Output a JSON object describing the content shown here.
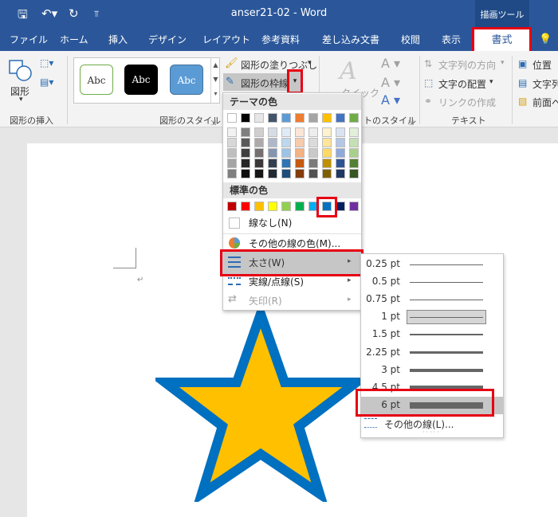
{
  "window": {
    "title": "anser21-02  -  Word",
    "drawing_tools": "描画ツール"
  },
  "tabs": [
    "ファイル",
    "ホーム",
    "挿入",
    "デザイン",
    "レイアウト",
    "参考資料",
    "差し込み文書",
    "校閲",
    "表示"
  ],
  "active_tab": "書式",
  "help_icon": "light-bulb-icon",
  "ribbon": {
    "insert_shapes": {
      "shape_label": "図形",
      "group_label": "図形の挿入"
    },
    "shape_styles": {
      "abc": [
        "Abc",
        "Abc",
        "Abc"
      ],
      "group_label": "図形のスタイル",
      "fill": "図形の塗りつぶし",
      "outline": "図形の枠線"
    },
    "wordart": {
      "quick_style": "クイック",
      "group_label": "トのスタイル"
    },
    "text": {
      "direction": "文字列の方向",
      "align": "文字の配置",
      "link": "リンクの作成",
      "group_label": "テキスト"
    },
    "arrange": {
      "position": "位置",
      "wrap": "文字列",
      "front": "前面へ"
    }
  },
  "dropdown": {
    "theme_colors_label": "テーマの色",
    "standard_colors_label": "標準の色",
    "no_outline": "線なし(N)",
    "more_colors": "その他の線の色(M)...",
    "weight": "太さ(W)",
    "dashes": "実線/点線(S)",
    "arrows": "矢印(R)",
    "theme_top": [
      "#ffffff",
      "#000000",
      "#e7e6e6",
      "#44546a",
      "#5b9bd5",
      "#ed7d31",
      "#a5a5a5",
      "#ffc000",
      "#4472c4",
      "#70ad47"
    ],
    "theme_shades": [
      [
        "#f2f2f2",
        "#7f7f7f",
        "#d0cece",
        "#d6dce4",
        "#deebf6",
        "#fbe5d5",
        "#ededed",
        "#fff2cc",
        "#dae3f3",
        "#e2efd9"
      ],
      [
        "#d8d8d8",
        "#595959",
        "#aeaaaa",
        "#adb9ca",
        "#bdd7ee",
        "#f7cbac",
        "#dbdbdb",
        "#fee599",
        "#b4c6e7",
        "#c5e0b3"
      ],
      [
        "#bfbfbf",
        "#3f3f3f",
        "#757070",
        "#8496b0",
        "#9dc3e6",
        "#f4b183",
        "#c9c9c9",
        "#ffd965",
        "#8eaadb",
        "#a8d08d"
      ],
      [
        "#a5a5a5",
        "#262626",
        "#3a3838",
        "#323f4f",
        "#2e75b5",
        "#c55a11",
        "#7b7b7b",
        "#bf9000",
        "#2f5496",
        "#538135"
      ],
      [
        "#7f7f7f",
        "#0c0c0c",
        "#171616",
        "#222a35",
        "#1e4e79",
        "#843c0b",
        "#525252",
        "#7f6000",
        "#1f3864",
        "#375623"
      ]
    ],
    "standard": [
      "#c00000",
      "#ff0000",
      "#ffc000",
      "#ffff00",
      "#92d050",
      "#00b050",
      "#00b0f0",
      "#0070c0",
      "#002060",
      "#7030a0"
    ]
  },
  "weights": {
    "items": [
      {
        "label": "0.25 pt",
        "thickness": 0.25
      },
      {
        "label": "0.5 pt",
        "thickness": 0.5
      },
      {
        "label": "0.75 pt",
        "thickness": 0.75
      },
      {
        "label": "1 pt",
        "thickness": 1
      },
      {
        "label": "1.5 pt",
        "thickness": 1.5
      },
      {
        "label": "2.25 pt",
        "thickness": 2.25
      },
      {
        "label": "3 pt",
        "thickness": 3
      },
      {
        "label": "4.5 pt",
        "thickness": 4.5
      },
      {
        "label": "6 pt",
        "thickness": 6
      }
    ],
    "more": "その他の線(L)..."
  },
  "colors": {
    "accent": "#2b579a",
    "highlight": "#e60012",
    "star_fill": "#ffc000",
    "star_stroke": "#0070c0"
  }
}
